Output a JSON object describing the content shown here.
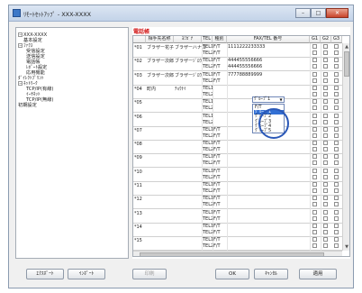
{
  "window": {
    "title": "ﾘﾓｰﾄｾｯﾄｱｯﾌﾟ - XXX-XXXX",
    "min_symbol": "–",
    "max_symbol": "□",
    "close_symbol": "✕"
  },
  "tree": [
    {
      "label": "XXX-XXXX",
      "pm": "−"
    },
    {
      "label": "基本設定"
    },
    {
      "label": "ﾌｧｸｽ",
      "pm": "−"
    },
    {
      "label": "受信設定"
    },
    {
      "label": "送信設定"
    },
    {
      "label": "電話帳"
    },
    {
      "label": "ﾚﾎﾟｰﾄ設定"
    },
    {
      "label": "応用機能"
    },
    {
      "label": "ﾀﾞｲﾚｸﾄﾌﾟﾘﾝﾄ"
    },
    {
      "label": "ﾈｯﾄﾜｰｸ",
      "pm": "−"
    },
    {
      "label": "TCP/IP(有線)"
    },
    {
      "label": "ｲｰｻﾈｯﾄ"
    },
    {
      "label": "TCP/IP(無線)"
    },
    {
      "label": "初期設定"
    }
  ],
  "phonebook": {
    "title": "電話帳",
    "headers": [
      "相手先名称",
      "ﾖﾐｶﾞﾅ",
      "TEL",
      "種別",
      "FAX/TEL 番号",
      "G1",
      "G2",
      "G3"
    ],
    "rows": [
      {
        "no": "*01",
        "name": "ブラザー花子",
        "kana": "ブラザーハナコ",
        "tel1": "TEL1",
        "type1": "F/T",
        "num1": "1111222233333",
        "tel2": "TEL2",
        "type2": "F/T",
        "num2": ""
      },
      {
        "no": "*02",
        "name": "ブラザー次郎",
        "kana": "ブラザーｼﾞﾛｳ",
        "tel1": "TEL1",
        "type1": "F/T",
        "num1": "444455556666",
        "tel2": "TEL2",
        "type2": "F/T",
        "num2": "444455556666"
      },
      {
        "no": "*03",
        "name": "ブラザー次郎",
        "kana": "ブラザーｼﾞﾛｳ",
        "tel1": "TEL1",
        "type1": "F/T",
        "num1": "777788889999",
        "tel2": "TEL2",
        "type2": "F/T",
        "num2": ""
      },
      {
        "no": "*04",
        "name": "町内",
        "kana": "ﾁｮｳﾅｲ",
        "tel1": "TEL1",
        "type1": "ｸﾞﾙｰﾌﾟ1",
        "num1": "",
        "tel2": "TEL2",
        "type2": "",
        "num2": ""
      },
      {
        "no": "*05",
        "name": "",
        "kana": "",
        "tel1": "TEL1",
        "type1": "",
        "num1": "",
        "tel2": "TEL2",
        "type2": "",
        "num2": ""
      },
      {
        "no": "*06",
        "name": "",
        "kana": "",
        "tel1": "TEL1",
        "type1": "",
        "num1": "",
        "tel2": "TEL2",
        "type2": "",
        "num2": ""
      },
      {
        "no": "*07",
        "name": "",
        "kana": "",
        "tel1": "TEL1",
        "type1": "F/T",
        "num1": "",
        "tel2": "TEL2",
        "type2": "F/T",
        "num2": ""
      },
      {
        "no": "*08",
        "name": "",
        "kana": "",
        "tel1": "TEL1",
        "type1": "F/T",
        "num1": "",
        "tel2": "TEL2",
        "type2": "F/T",
        "num2": ""
      },
      {
        "no": "*09",
        "name": "",
        "kana": "",
        "tel1": "TEL1",
        "type1": "F/T",
        "num1": "",
        "tel2": "TEL2",
        "type2": "F/T",
        "num2": ""
      },
      {
        "no": "*10",
        "name": "",
        "kana": "",
        "tel1": "TEL1",
        "type1": "F/T",
        "num1": "",
        "tel2": "TEL2",
        "type2": "F/T",
        "num2": ""
      },
      {
        "no": "*11",
        "name": "",
        "kana": "",
        "tel1": "TEL1",
        "type1": "F/T",
        "num1": "",
        "tel2": "TEL2",
        "type2": "F/T",
        "num2": ""
      },
      {
        "no": "*12",
        "name": "",
        "kana": "",
        "tel1": "TEL1",
        "type1": "F/T",
        "num1": "",
        "tel2": "TEL2",
        "type2": "F/T",
        "num2": ""
      },
      {
        "no": "*13",
        "name": "",
        "kana": "",
        "tel1": "TEL1",
        "type1": "F/T",
        "num1": "",
        "tel2": "TEL2",
        "type2": "F/T",
        "num2": ""
      },
      {
        "no": "*14",
        "name": "",
        "kana": "",
        "tel1": "TEL1",
        "type1": "F/T",
        "num1": "",
        "tel2": "TEL2",
        "type2": "F/T",
        "num2": ""
      },
      {
        "no": "*15",
        "name": "",
        "kana": "",
        "tel1": "TEL1",
        "type1": "F/T",
        "num1": "",
        "tel2": "TEL2",
        "type2": "F/T",
        "num2": ""
      }
    ],
    "dropdown": {
      "current": "ｸﾞﾙｰﾌﾟ1",
      "options": [
        "F/T",
        "ｸﾞﾙｰﾌﾟ1",
        "ｸﾞﾙｰﾌﾟ2",
        "ｸﾞﾙｰﾌﾟ3",
        "ｸﾞﾙｰﾌﾟ4",
        "ｸﾞﾙｰﾌﾟ5"
      ],
      "selected_index": 1
    },
    "scroll_up": "▲",
    "scroll_down": "▼"
  },
  "buttons": {
    "export": "ｴｸｽﾎﾟｰﾄ",
    "import": "ｲﾝﾎﾟｰﾄ",
    "print": "印刷",
    "ok": "OK",
    "cancel": "ｷｬﾝｾﾙ",
    "apply": "適用"
  }
}
